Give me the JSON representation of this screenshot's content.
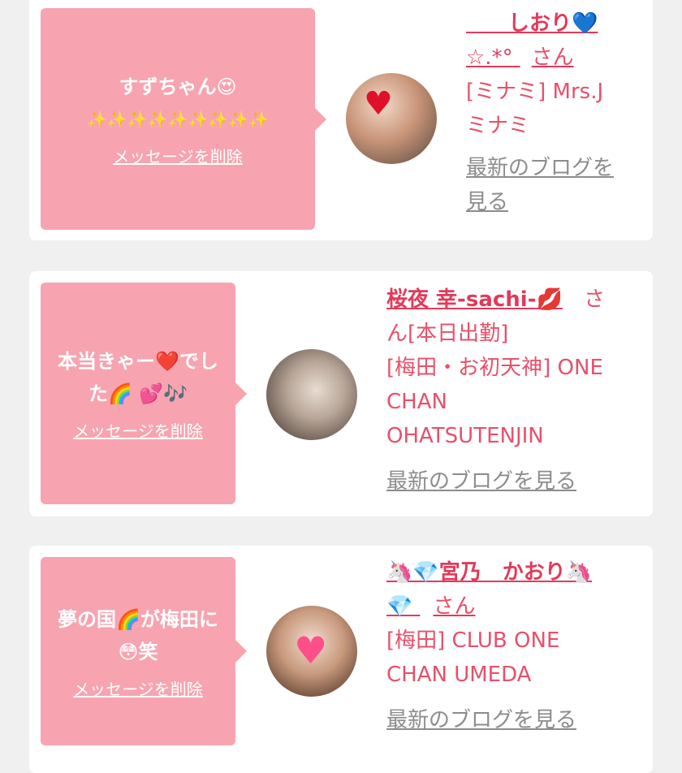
{
  "colors": {
    "background": "#f0f0f0",
    "card": "#ffffff",
    "bubble": "#f7a4b0",
    "name": "#e23a5a",
    "text_pink": "#e8506a",
    "link_gray": "#8c8c8c"
  },
  "messages": [
    {
      "message_line1": "すずちゃん😍",
      "message_line2": "✨✨✨✨✨✨✨✨✨",
      "delete_label": "メッセージを削除",
      "name_line1": "　　しおり💙",
      "name_line2": "☆.*°",
      "san": "さん",
      "shop_line1": "[ミナミ] Mrs.J",
      "shop_line2": "ミナミ",
      "blog_line1": "最新のブログを",
      "blog_line2": "見る",
      "avatar_icon": "heart-icon"
    },
    {
      "message_line1": "本当きゃー❤️でし",
      "message_line2": "た🌈 💕🎶",
      "delete_label": "メッセージを削除",
      "name_line1": "桜夜 幸-sachi-💋",
      "san_line1": "さ",
      "san_line2": "ん",
      "status": "[本日出勤]",
      "shop_line1": "[梅田・お初天神] ONE",
      "shop_line2": "CHAN",
      "shop_line3": "OHATSUTENJIN",
      "blog_label": "最新のブログを見る",
      "avatar_icon": "portrait-photo"
    },
    {
      "message_line1": "夢の国🌈が梅田に",
      "message_line2": "😳笑",
      "delete_label": "メッセージを削除",
      "name_line1": "🦄💎宮乃　かおり🦄",
      "name_line2": "💎",
      "san": "さん",
      "shop_line1": "[梅田] CLUB ONE",
      "shop_line2": "CHAN UMEDA",
      "blog_label": "最新のブログを見る",
      "avatar_icon": "pink-heart-icon"
    }
  ]
}
